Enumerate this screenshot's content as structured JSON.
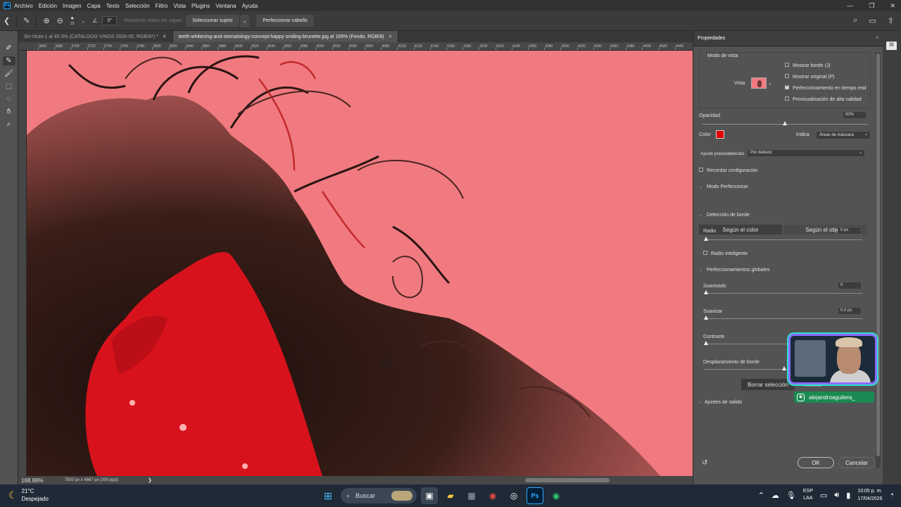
{
  "app": {
    "logo": "Ps",
    "menu": [
      "Archivo",
      "Edición",
      "Imagen",
      "Capa",
      "Texto",
      "Selección",
      "Filtro",
      "Vista",
      "Plugins",
      "Ventana",
      "Ayuda"
    ],
    "window_controls": [
      "—",
      "❐",
      "✕"
    ]
  },
  "options_bar": {
    "brush_size": "15",
    "angle": "0°",
    "sample_all_layers": "Muestrear todas las capas",
    "select_subject": "Seleccionar sujeto",
    "refine_hair": "Perfeccionar cabello"
  },
  "tabs": [
    {
      "label": "Sin título-1 al 45.3% (CATALOGO VINOS 2026-05, RGB/8*) *",
      "active": false
    },
    {
      "label": "teeth-whitening-and-stomatology-concept-happy-smiling-brunette.jpg al 169% (Fondo, RGB/8)",
      "active": true
    }
  ],
  "ruler_labels": [
    "3660",
    "3680",
    "3700",
    "3720",
    "3740",
    "3760",
    "3780",
    "3800",
    "3820",
    "3840",
    "3860",
    "3880",
    "3900",
    "3920",
    "3940",
    "3960",
    "3980",
    "4000",
    "4020",
    "4040",
    "4060",
    "4080",
    "4100",
    "4120",
    "4140",
    "4160",
    "4180",
    "4200",
    "4220",
    "4240",
    "4260",
    "4280",
    "4300",
    "4320",
    "4340",
    "4360",
    "4380",
    "4400",
    "4420",
    "4440"
  ],
  "status": {
    "zoom": "168.88%",
    "doc_info": "7000 px x 4667 px (300 ppp)"
  },
  "properties": {
    "title": "Propiedades",
    "view_mode_label": "Modo de vista",
    "view_label": "Vista",
    "show_edge": "Mostrar borde (J)",
    "show_original": "Mostrar original (P)",
    "realtime_refine": "Perfeccionamiento en tiempo real",
    "hq_preview": "Previsualización de alta calidad",
    "checks": {
      "show_edge": false,
      "show_original": false,
      "realtime_refine": true,
      "hq_preview": false
    },
    "opacity_label": "Opacidad",
    "opacity_value": "50%",
    "opacity_fraction": 0.5,
    "color_label": "Color",
    "overlay_color": "#e00000",
    "indicates_label": "Indica",
    "indicates_value": "Áreas de máscara",
    "preset_label": "Ajuste preestablecido",
    "preset_value": "Por defecto",
    "remember_settings": "Recordar configuración",
    "refine_mode_label": "Modo Perfeccionar",
    "mode_color": "Según el color",
    "mode_object": "Según el objeto",
    "edge_detection_label": "Detección de borde",
    "radius_label": "Radio",
    "radius_value": "0 px",
    "smart_radius": "Radio inteligente",
    "global_refinements_label": "Perfeccionamientos globales",
    "smooth_label": "Suavizado",
    "smooth_value": "0",
    "feather_label": "Suavizar",
    "feather_value": "0.0 px",
    "contrast_label": "Contraste",
    "shift_edge_label": "Desplazamiento de borde",
    "clear_selection": "Borrar selección",
    "invert": "Invertir",
    "output_settings": "Ajustes de salida",
    "ok": "OK",
    "cancel": "Cancelar"
  },
  "webcam": {
    "handle": "alejandroaguilera_"
  },
  "taskbar": {
    "temperature": "21°C",
    "weather": "Despejado",
    "search_placeholder": "Buscar",
    "lang_top": "ESP",
    "lang_bottom": "LAA",
    "time": "10:05 p. m.",
    "date": "17/04/2026"
  },
  "colors": {
    "overlay_pink": "#f07a80",
    "panel_bg": "#535353",
    "ps_blue": "#31a8ff"
  }
}
